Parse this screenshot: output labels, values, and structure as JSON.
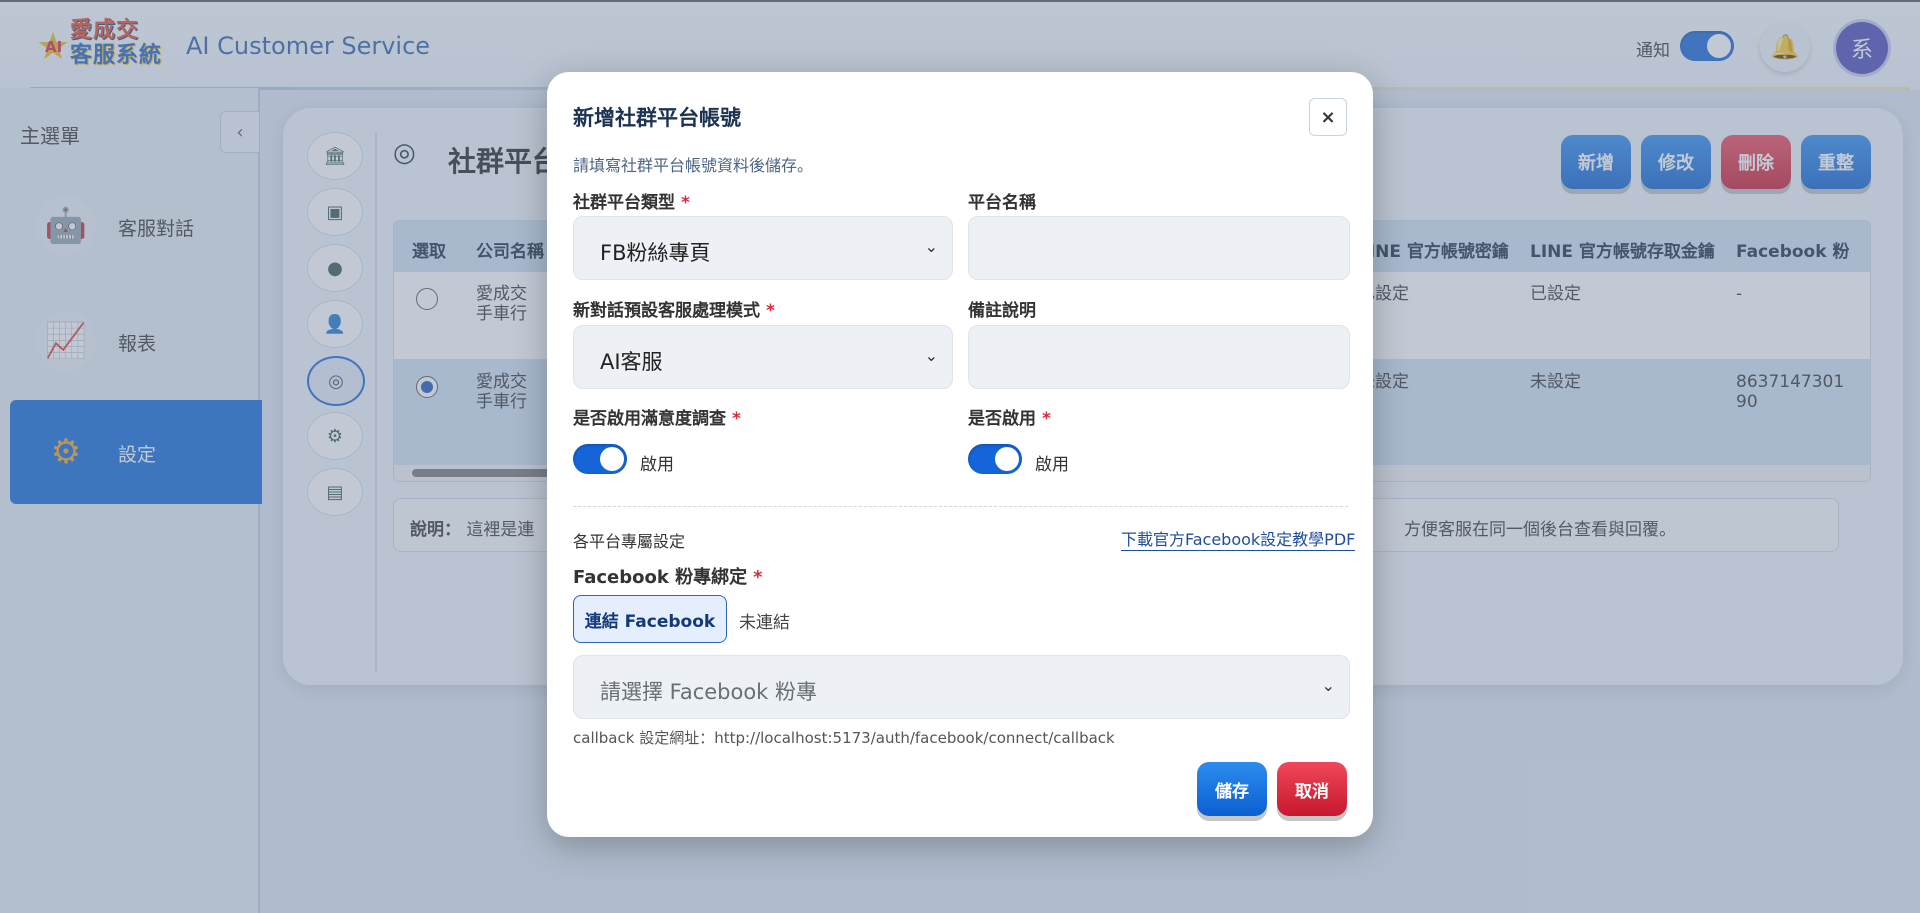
{
  "header": {
    "logo_line1": "愛成交",
    "logo_line2": "客服系統",
    "logo_badge": "AI",
    "app_title": "AI Customer Service",
    "notify_label": "通知",
    "notify_on": true,
    "avatar_text": "系"
  },
  "sidebar": {
    "title": "主選單",
    "collapse_glyph": "‹",
    "items": [
      {
        "label": "客服對話",
        "icon": "robot-icon"
      },
      {
        "label": "報表",
        "icon": "report-chart-icon"
      },
      {
        "label": "設定",
        "icon": "gear-icon",
        "active": true
      }
    ]
  },
  "main": {
    "page_title": "社群平台",
    "actions": {
      "add": "新增",
      "edit": "修改",
      "delete": "刪除",
      "reset": "重整"
    },
    "table": {
      "headers": {
        "select": "選取",
        "company": "公司名稱",
        "line_secret": "LINE 官方帳號密鑰",
        "line_token": "LINE 官方帳號存取金鑰",
        "facebook": "Facebook 粉"
      },
      "rows": [
        {
          "company_l1": "愛成交",
          "company_l2": "手車行",
          "line_secret": "已設定",
          "line_token": "已設定",
          "facebook": "-",
          "selected": false
        },
        {
          "company_l1": "愛成交",
          "company_l2": "手車行",
          "line_secret": "未設定",
          "line_token": "未設定",
          "facebook": "8637147301 90",
          "selected": true
        }
      ]
    },
    "note_label": "說明：",
    "note_text_left": "這裡是連",
    "note_text_right": "方便客服在同一個後台查看與回覆。"
  },
  "modal": {
    "title": "新增社群平台帳號",
    "close_glyph": "×",
    "subtitle": "請填寫社群平台帳號資料後儲存。",
    "platform_type_label": "社群平台類型",
    "platform_type_value": "FB粉絲專頁",
    "platform_name_label": "平台名稱",
    "platform_name_value": "",
    "default_mode_label": "新對話預設客服處理模式",
    "default_mode_value": "AI客服",
    "remark_label": "備註說明",
    "remark_value": "",
    "survey_label": "是否啟用滿意度調查",
    "survey_toggle_text": "啟用",
    "survey_on": true,
    "enable_label": "是否啟用",
    "enable_toggle_text": "啟用",
    "enable_on": true,
    "section_label": "各平台專屬設定",
    "pdf_link": "下載官方Facebook設定教學PDF",
    "fb_bind_label": "Facebook 粉專綁定",
    "fb_connect_button": "連結 Facebook",
    "fb_status": "未連結",
    "fb_page_placeholder": "請選擇 Facebook 粉專",
    "callback_text": "callback 設定網址：http://localhost:5173/auth/facebook/connect/callback",
    "save_label": "儲存",
    "cancel_label": "取消",
    "required_mark": "*"
  }
}
